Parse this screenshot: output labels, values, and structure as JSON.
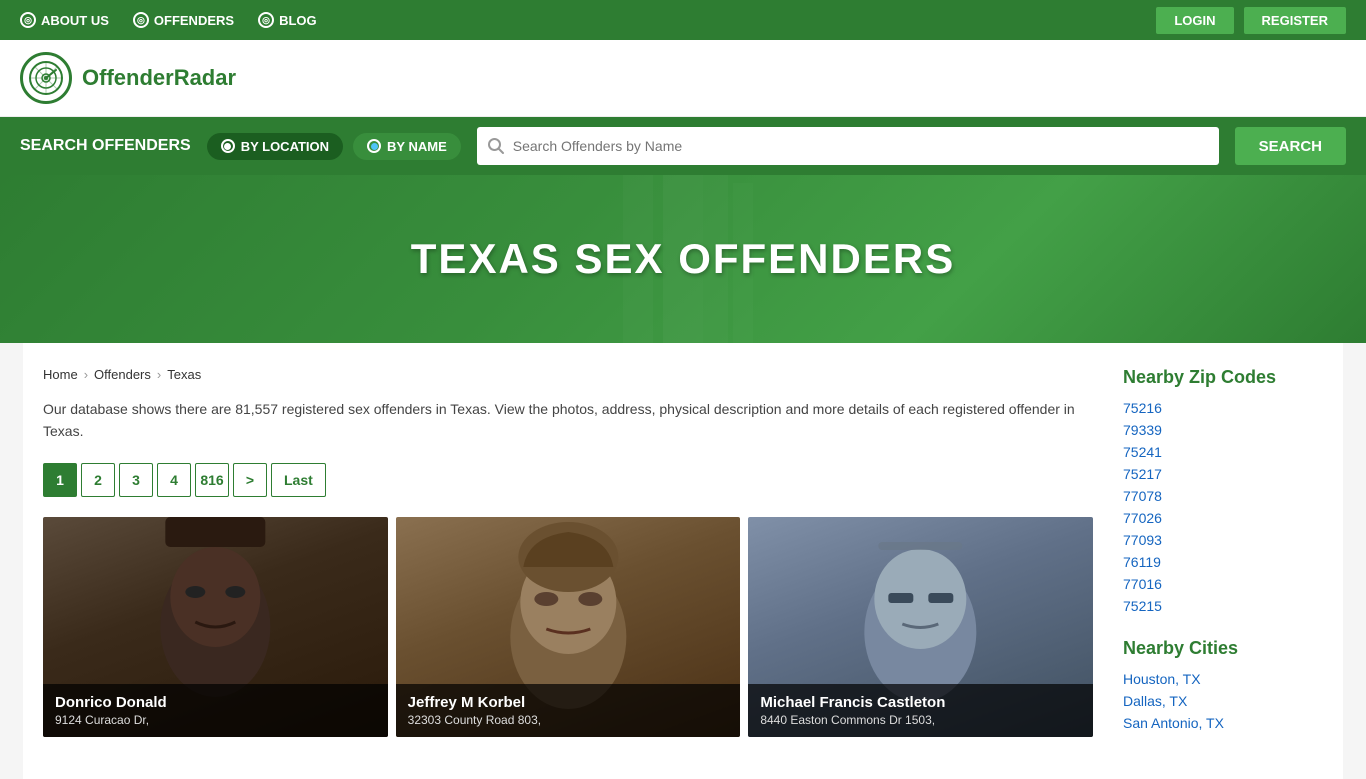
{
  "topNav": {
    "items": [
      {
        "label": "ABOUT US",
        "id": "about-us"
      },
      {
        "label": "OFFENDERS",
        "id": "offenders"
      },
      {
        "label": "BLOG",
        "id": "blog"
      }
    ],
    "buttons": [
      {
        "label": "LOGIN",
        "id": "login"
      },
      {
        "label": "REGISTER",
        "id": "register"
      }
    ]
  },
  "logo": {
    "text_plain": "Offender",
    "text_accent": "Radar"
  },
  "searchBar": {
    "label": "SEARCH OFFENDERS",
    "radio_location": "BY LOCATION",
    "radio_name": "BY NAME",
    "placeholder": "Search Offenders by Name",
    "button": "SEARCH"
  },
  "hero": {
    "title": "TEXAS SEX OFFENDERS"
  },
  "breadcrumb": {
    "home": "Home",
    "offenders": "Offenders",
    "current": "Texas"
  },
  "description": "Our database shows there are 81,557 registered sex offenders in Texas. View the photos, address, physical description and more details of each registered offender in Texas.",
  "pagination": {
    "pages": [
      "1",
      "2",
      "3",
      "4",
      "816"
    ],
    "next": ">",
    "last": "Last"
  },
  "offenders": [
    {
      "name": "Donrico Donald",
      "address": "9124 Curacao Dr,",
      "img_color": "#6b6060"
    },
    {
      "name": "Jeffrey M Korbel",
      "address": "32303 County Road 803,",
      "img_color": "#7a6a48"
    },
    {
      "name": "Michael Francis Castleton",
      "address": "8440 Easton Commons Dr 1503,",
      "img_color": "#7a8898"
    }
  ],
  "sidebar": {
    "zipcodes_title": "Nearby Zip Codes",
    "zipcodes": [
      "75216",
      "79339",
      "75241",
      "75217",
      "77078",
      "77026",
      "77093",
      "76119",
      "77016",
      "75215"
    ],
    "cities_title": "Nearby Cities",
    "cities": [
      "Houston, TX",
      "Dallas, TX",
      "San Antonio, TX"
    ]
  }
}
